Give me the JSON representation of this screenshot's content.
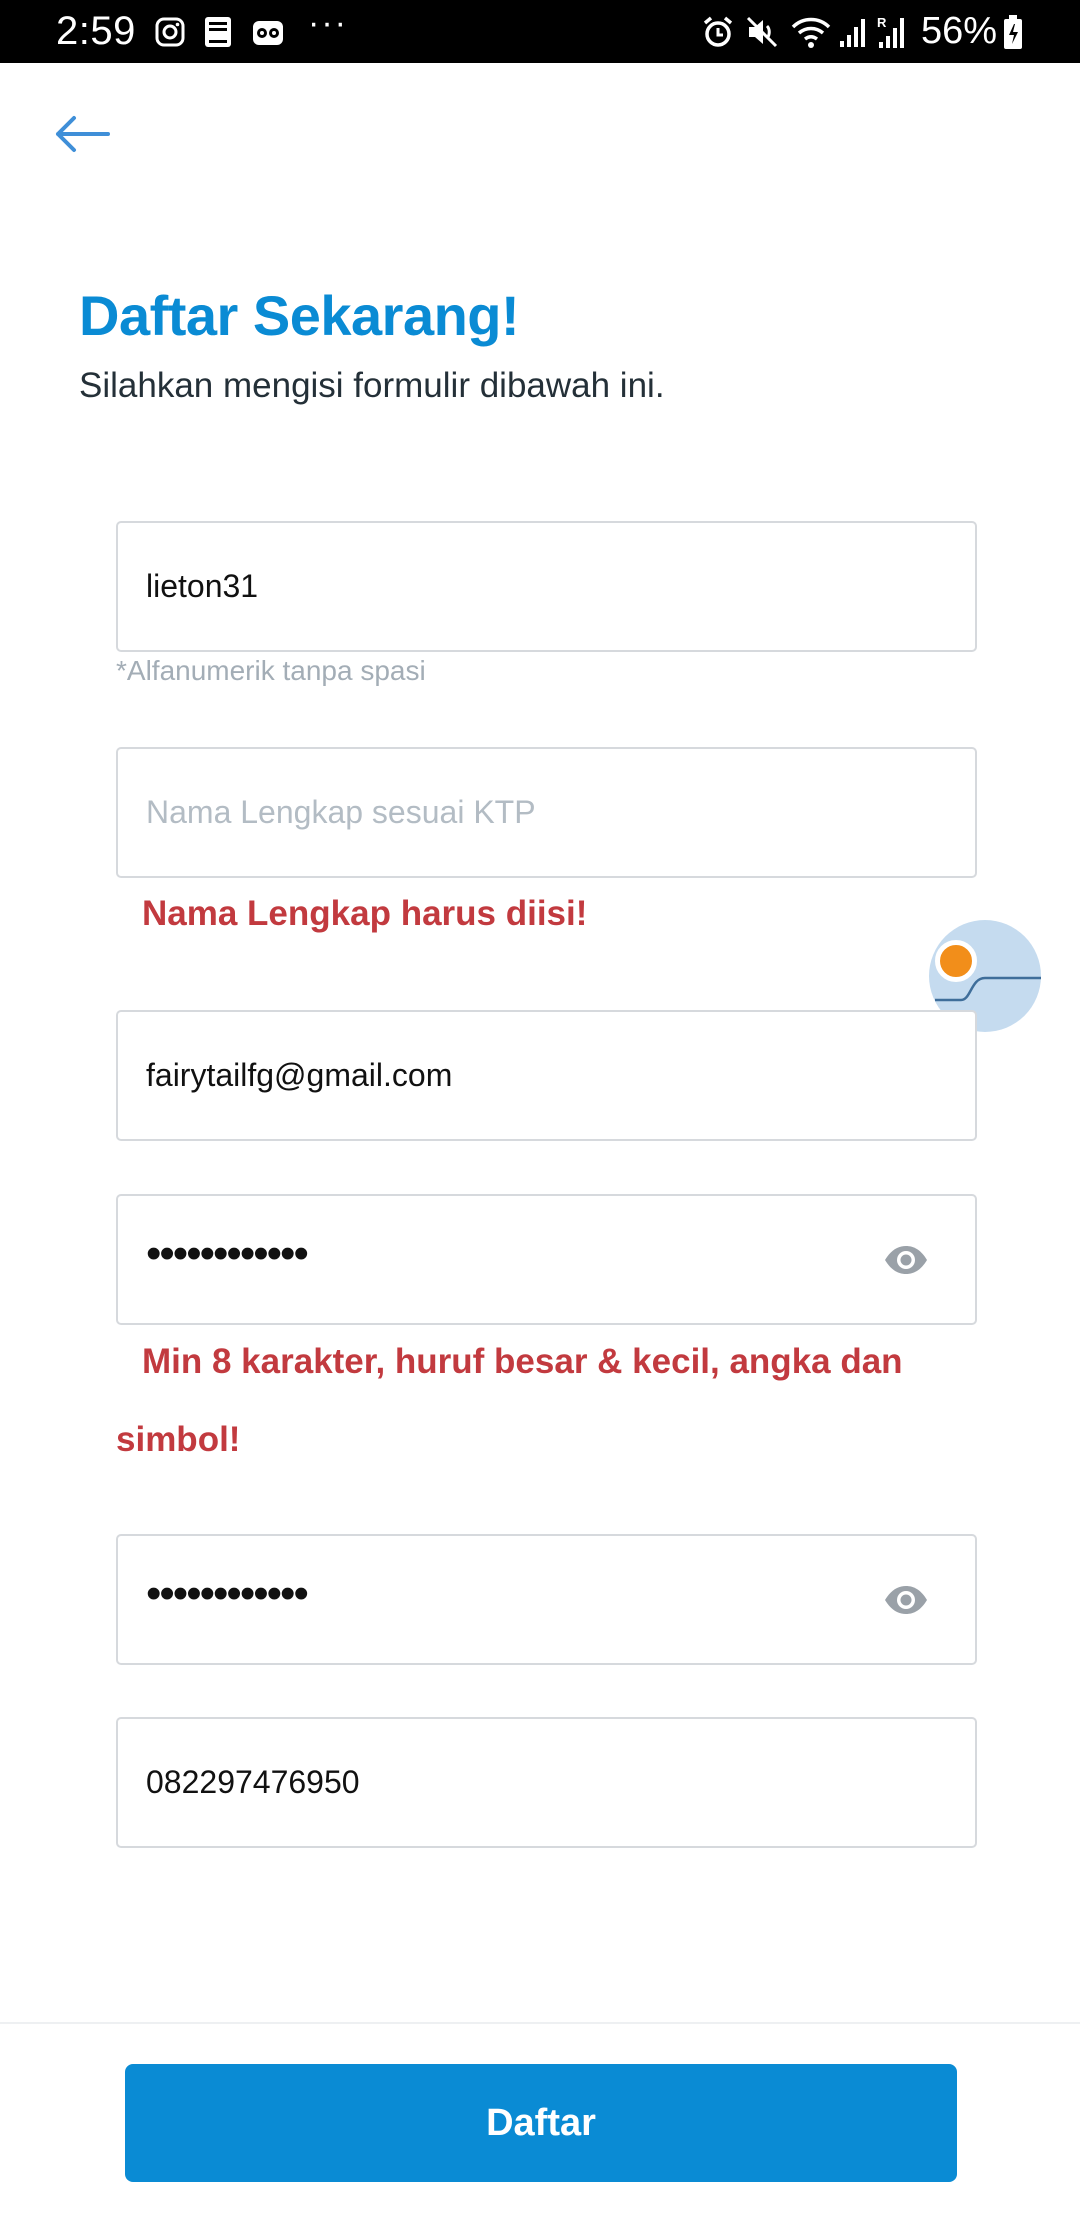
{
  "status_bar": {
    "time": "2:59",
    "more": "···",
    "battery_percent": "56%",
    "left_icons": [
      "instagram-icon",
      "bible-icon",
      "tripadvisor-icon"
    ],
    "right_icons": [
      "alarm-icon",
      "mute-icon",
      "wifi-icon",
      "signal-icon",
      "signal-roaming-icon",
      "battery-icon"
    ]
  },
  "header": {
    "back_icon": "arrow-left-icon",
    "title": "Daftar Sekarang!",
    "subtitle": "Silahkan mengisi formulir dibawah ini."
  },
  "form": {
    "username": {
      "value": "lieton31",
      "hint": "*Alfanumerik tanpa spasi"
    },
    "full_name": {
      "value": "",
      "placeholder": "Nama Lengkap sesuai KTP",
      "error": "Nama Lengkap harus diisi!"
    },
    "email": {
      "value": "fairytailfg@gmail.com"
    },
    "password": {
      "masked_value": "••••••••••••",
      "error_line1": "Min 8 karakter, huruf besar & kecil, angka dan",
      "error_line2": "simbol!"
    },
    "confirm_password": {
      "masked_value": "••••••••••••"
    },
    "phone": {
      "value": "082297476950"
    }
  },
  "submit_label": "Daftar",
  "colors": {
    "accent": "#0a8bd4",
    "error": "#c23a3f",
    "hint": "#a3adb6",
    "bubble": "#f28e1a"
  }
}
